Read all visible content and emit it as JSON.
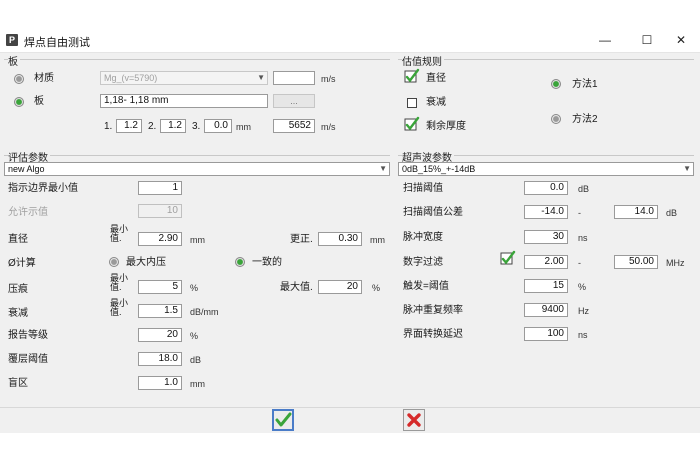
{
  "window": {
    "app_badge": "P",
    "title": "焊点自由测试",
    "minimize": "—",
    "maximize": "☐",
    "close": "✕"
  },
  "plate": {
    "group_title": "板",
    "material_label": "材质",
    "material_value": "Mg_(v=5790)",
    "material_velocity_unit": "m/s",
    "plate_label": "板",
    "plate_value": "1,18- 1,18 mm",
    "browse_label": "...",
    "layer1_label": "1.",
    "layer1_value": "1.2",
    "layer2_label": "2.",
    "layer2_value": "1.2",
    "layer3_label": "3.",
    "layer3_value": "0.0",
    "thickness_unit": "mm",
    "velocity_value": "5652",
    "velocity_unit": "m/s"
  },
  "rules": {
    "group_title": "估值规则",
    "diameter_label": "直径",
    "attenuation_label": "衰减",
    "remaining_thickness_label": "剩余厚度",
    "method1_label": "方法1",
    "method2_label": "方法2"
  },
  "eval": {
    "group_title": "评估参数",
    "algo_value": "new Algo",
    "min_boundary_label": "指示边界最小值",
    "min_boundary_value": "1",
    "allowed_label": "允许示值",
    "allowed_value": "10",
    "diameter_label": "直径",
    "min_label": "最小值.",
    "diameter_min_value": "2.90",
    "diameter_unit": "mm",
    "correction_label": "更正.",
    "correction_value": "0.30",
    "correction_unit": "mm",
    "calc_label": "Ø计算",
    "max_indent_label": "最大内压",
    "uniform_label": "一致的",
    "indent_label": "压痕",
    "indent_min_value": "5",
    "indent_unit": "%",
    "max_label": "最大值.",
    "indent_max_value": "20",
    "indent_max_unit": "%",
    "atten_label": "衰减",
    "atten_min_value": "1.5",
    "atten_unit": "dB/mm",
    "report_label": "报告等级",
    "report_value": "20",
    "report_unit": "%",
    "cover_label": "覆层阈值",
    "cover_value": "18.0",
    "cover_unit": "dB",
    "dead_label": "盲区",
    "dead_value": "1.0",
    "dead_unit": "mm"
  },
  "ultra": {
    "group_title": "超声波参数",
    "profile_value": "0dB_15%_+-14dB",
    "scan_threshold_label": "扫描阈值",
    "scan_threshold_value": "0.0",
    "scan_threshold_unit": "dB",
    "scan_tol_label": "扫描阈值公差",
    "scan_tol_low": "-14.0",
    "scan_tol_dash": "-",
    "scan_tol_high": "14.0",
    "scan_tol_unit": "dB",
    "pulse_width_label": "脉冲宽度",
    "pulse_width_value": "30",
    "pulse_width_unit": "ns",
    "digital_filter_label": "数字过滤",
    "filter_low": "2.00",
    "filter_dash": "-",
    "filter_high": "50.00",
    "filter_unit": "MHz",
    "trigger_label": "触发=阈值",
    "trigger_value": "15",
    "trigger_unit": "%",
    "prf_label": "脉冲重复频率",
    "prf_value": "9400",
    "prf_unit": "Hz",
    "interface_label": "界面转换延迟",
    "interface_value": "100",
    "interface_unit": "ns"
  },
  "colors": {
    "accent_blue": "#4a7cc8",
    "check_green": "#3aa43a",
    "cancel_red": "#d62a2a"
  }
}
